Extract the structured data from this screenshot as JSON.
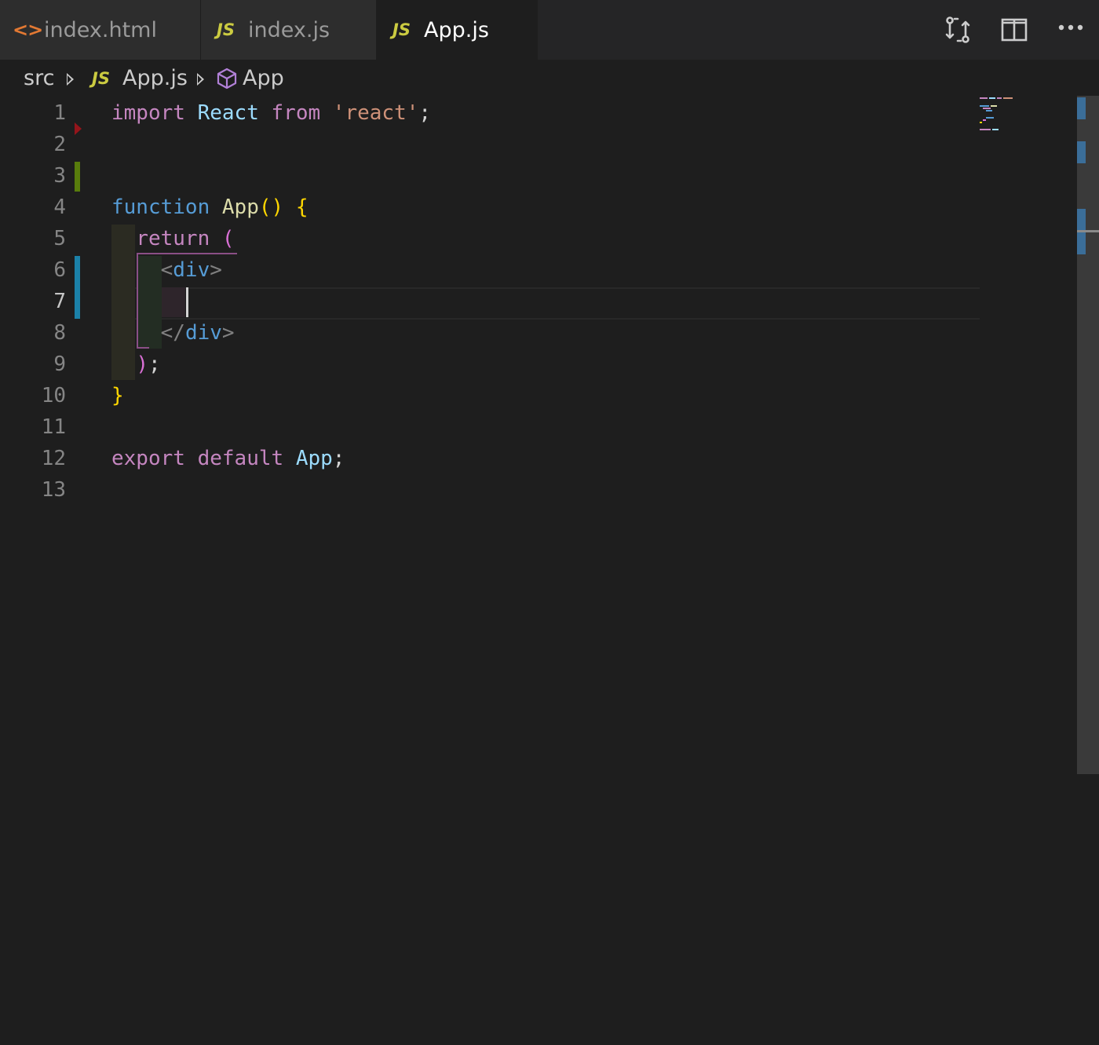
{
  "tabs": [
    {
      "label": "index.html",
      "icon": "html-file-icon",
      "icon_text": "<>",
      "active": false
    },
    {
      "label": "index.js",
      "icon": "js-file-icon",
      "icon_text": "JS",
      "active": false
    },
    {
      "label": "App.js",
      "icon": "js-file-icon",
      "icon_text": "JS",
      "active": true
    }
  ],
  "tab_actions": [
    "open-changes-icon",
    "split-editor-icon",
    "more-actions-icon"
  ],
  "breadcrumb": {
    "folder": "src",
    "file_icon_text": "JS",
    "file": "App.js",
    "symbol_icon": "symbol-class-icon",
    "symbol": "App"
  },
  "editor": {
    "line_numbers": [
      "1",
      "2",
      "3",
      "4",
      "5",
      "6",
      "7",
      "8",
      "9",
      "10",
      "11",
      "12",
      "13"
    ],
    "current_line": 7,
    "lines": {
      "l1": {
        "import": "import",
        "react": "React",
        "from": "from",
        "module": "'react'",
        "semi": ";"
      },
      "l4": {
        "function": "function",
        "name": "App",
        "parens": "()",
        "brace": "{"
      },
      "l5": {
        "return": "return",
        "paren": "("
      },
      "l6": {
        "open_lt": "<",
        "tag": "div",
        "open_gt": ">"
      },
      "l8": {
        "close_lt": "</",
        "tag": "div",
        "close_gt": ">"
      },
      "l9": {
        "paren": ")",
        "semi": ";"
      },
      "l10": {
        "brace": "}"
      },
      "l12": {
        "export": "export",
        "default": "default",
        "name": "App",
        "semi": ";"
      }
    }
  },
  "colors": {
    "background": "#1e1e1e",
    "keyword_pink": "#c586c0",
    "keyword_blue": "#569cd6",
    "identifier": "#9cdcfe",
    "string": "#ce9178",
    "bracket_gold": "#ffd700",
    "gutter_added": "#587c0c",
    "gutter_modified": "#1b81a8",
    "gutter_deleted": "#94151b"
  }
}
